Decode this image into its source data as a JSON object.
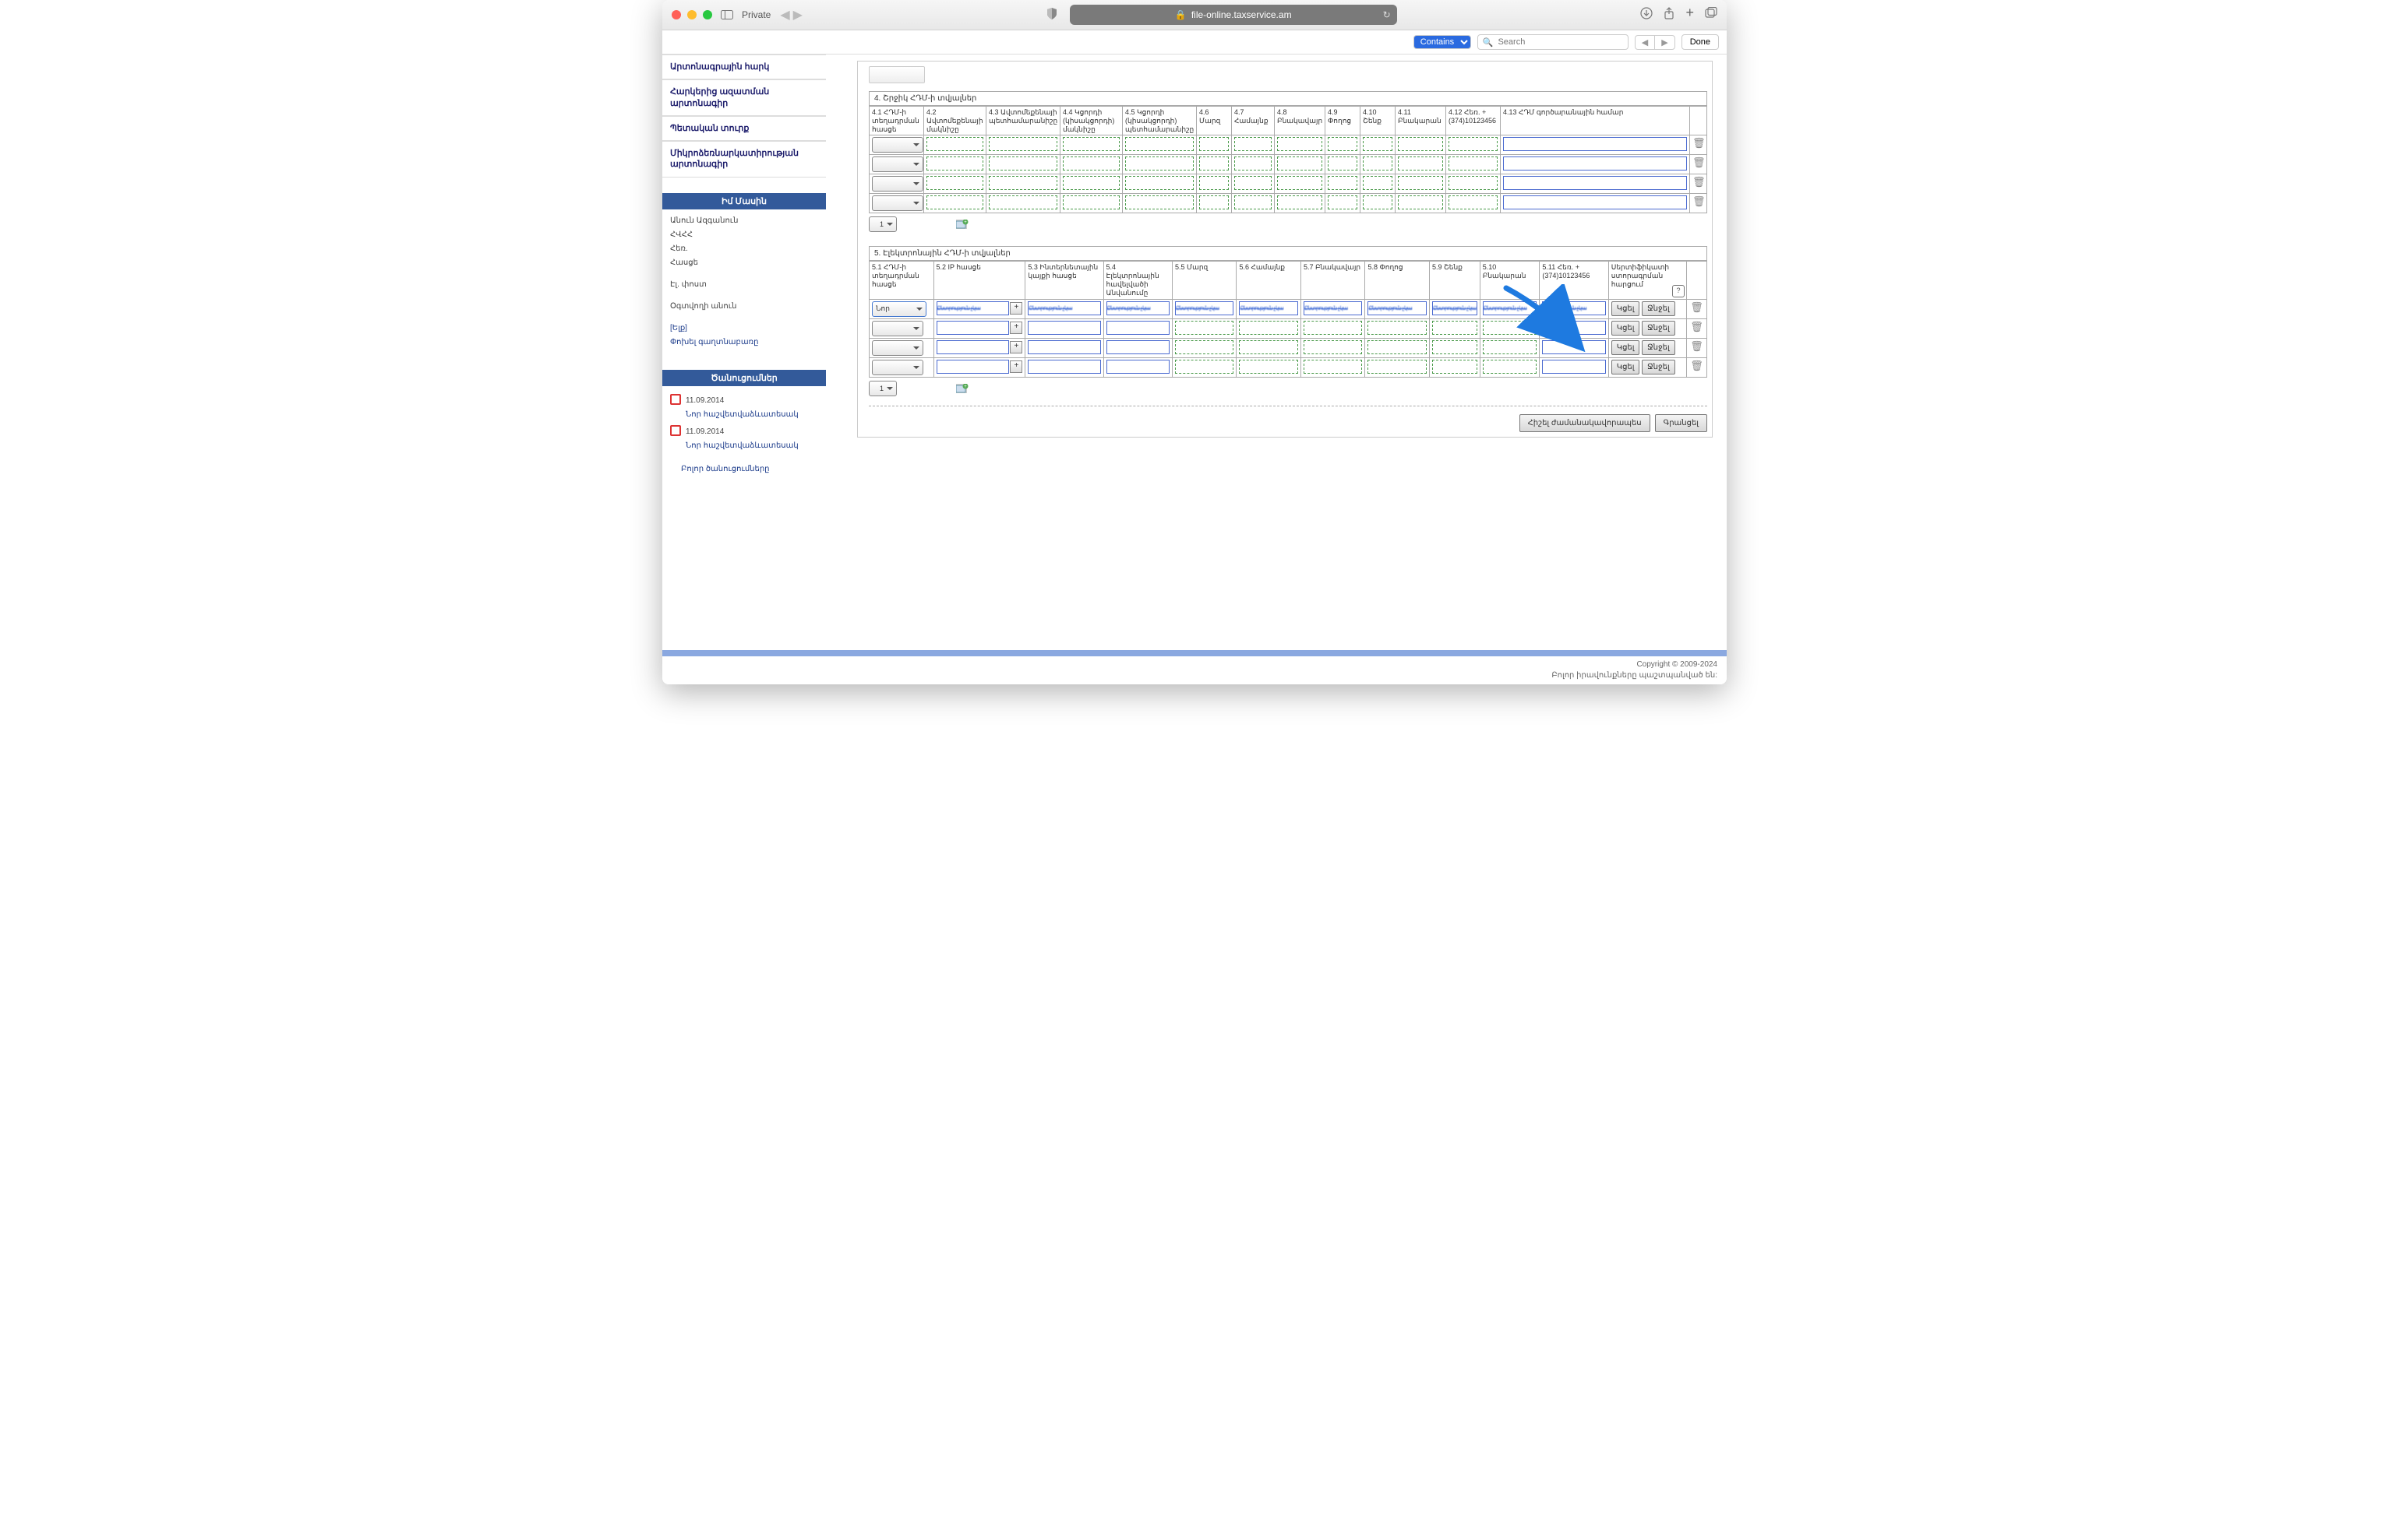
{
  "browser": {
    "private_label": "Private",
    "url": "file-online.taxservice.am",
    "find_mode": "Contains",
    "search_placeholder": "Search",
    "done": "Done"
  },
  "sidebar": {
    "nav": [
      "Արտոնագրային հարկ",
      "Հարկերից ազատման արտոնագիր",
      "Պետական տուրք",
      "Միկրոձեռնարկատիրության արտոնագիր"
    ],
    "about": {
      "title": "Իմ Մասին",
      "rows": [
        "Անուն Ազգանուն",
        "ՀՎՀՀ",
        "Հեռ.",
        "Հասցե",
        "",
        "Էլ. փոստ",
        "",
        "Օգտվողի անուն"
      ],
      "exit": "[Ելք]",
      "change_pw": "Փոխել գաղտնաբառը"
    },
    "notices": {
      "title": "Ծանուցումներ",
      "items": [
        {
          "date": "11.09.2014",
          "title": "Նոր հաշվետվաձևատեսակ"
        },
        {
          "date": "11.09.2014",
          "title": "Նոր հաշվետվաձևատեսակ"
        }
      ],
      "all": "Բոլոր ծանուցումները"
    }
  },
  "section4": {
    "title": "4. Շրջիկ ՀԴՄ-ի տվյալներ",
    "cols": [
      "4.1 ՀԴՄ-ի տեղադրման հասցե",
      "4.2 Ավտոմեքենայի մակնիշը",
      "4.3 Ավտոմեքենայի պետհամարանիշը",
      "4.4 Կցորդի (կիսակցորդի) մակնիշը",
      "4.5 Կցորդի (կիսակցորդի) պետհամարանիշը",
      "4.6 Մարզ",
      "4.7 Համայնք",
      "4.8 Բնակավայր",
      "4.9 Փողոց",
      "4.10 Շենք",
      "4.11 Բնակարան",
      "4.12 Հեռ. + (374)10123456",
      "4.13 ՀԴՄ գործարանային համար"
    ],
    "page": "1"
  },
  "section5": {
    "title": "5. Էլեկտրոնային ՀԴՄ-ի տվյալներ",
    "cols": [
      "5.1 ՀԴՄ-ի տեղադրման հասցե",
      "5.2 IP հասցե",
      "5.3 Ինտերնետային կայքի հասցե",
      "5.4 Էլեկտրոնային հավելվածի Անվանումը",
      "5.5 Մարզ",
      "5.6 Համայնք",
      "5.7 Բնակավայր",
      "5.8 Փողոց",
      "5.9 Շենք",
      "5.10 Բնակարան",
      "5.11 Հեռ. + (374)10123456",
      "Սերտիֆիկատի ստորագրման հարցում"
    ],
    "new_opt": "Նոր",
    "placeholder": "Ընտրություն չկա",
    "btn_save": "Կցել",
    "btn_del": "Ջնջել",
    "page": "1"
  },
  "actions": {
    "remember": "Հիշել ժամանակավորապես",
    "register": "Գրանցել"
  },
  "footer": {
    "copyright": "Copyright © 2009-2024",
    "rights": "Բոլոր իրավունքները պաշտպանված են:"
  }
}
